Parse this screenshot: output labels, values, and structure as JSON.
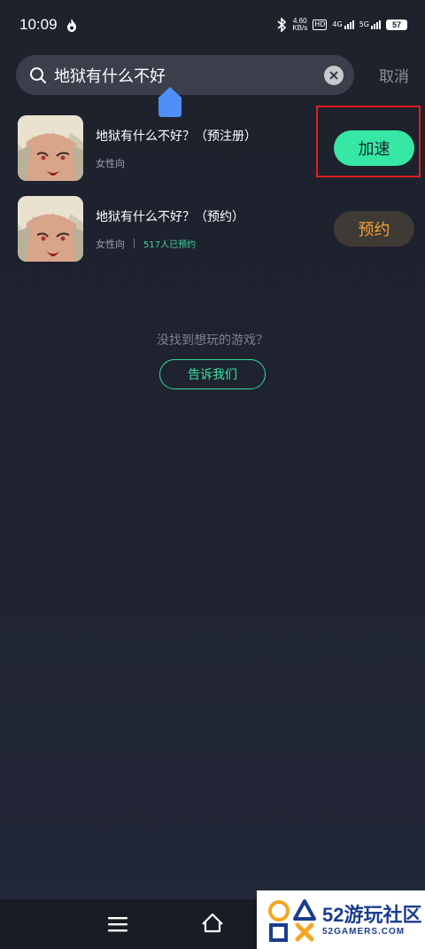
{
  "status_bar": {
    "time": "10:09",
    "speed_value": "4.60",
    "speed_unit": "KB/s",
    "hd_label": "HD",
    "net1_label": "4G",
    "net2_label": "5G",
    "battery": "57"
  },
  "search": {
    "query": "地狱有什么不好",
    "cancel_label": "取消"
  },
  "results": [
    {
      "title": "地狱有什么不好？（预注册）",
      "tag": "女性向",
      "reserve_count": "",
      "action_label": "加速",
      "action_type": "speed"
    },
    {
      "title": "地狱有什么不好？（预约）",
      "tag": "女性向",
      "reserve_count": "517人已预约",
      "action_label": "预约",
      "action_type": "reserve"
    }
  ],
  "empty": {
    "hint": "没找到想玩的游戏？",
    "tell_us_label": "告诉我们"
  },
  "watermark": {
    "brand": "52游玩社区",
    "domain": "52GAMERS.COM"
  },
  "colors": {
    "accent_green": "#36e8a3",
    "reserve_orange": "#f3a03a",
    "highlight_red": "#e01d1d"
  }
}
